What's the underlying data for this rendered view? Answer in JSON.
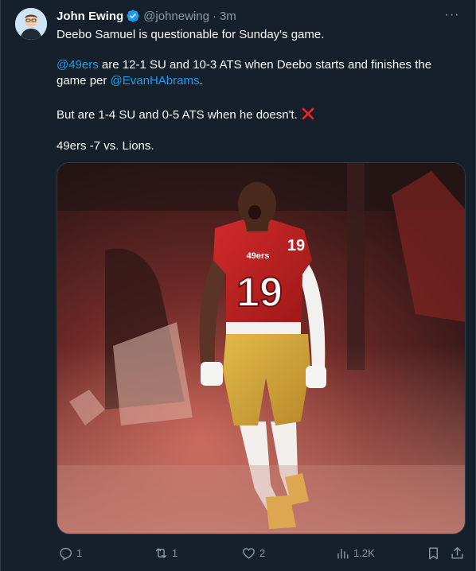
{
  "author": {
    "name": "John Ewing",
    "handle": "@johnewing",
    "separator": "·",
    "time": "3m"
  },
  "menu": {
    "label": "···"
  },
  "tweet": {
    "line1": "Deebo Samuel is questionable for Sunday's game.",
    "line2": {
      "mention1": "@49ers",
      "text_a": " are 12-1 SU and 10-3 ATS when Deebo starts and finishes the",
      "text_b": "game per ",
      "mention2": "@EvanHAbrams",
      "text_c": "."
    },
    "line3": "But are 1-4 SU and 0-5 ATS when he doesn't.",
    "line4": "49ers -7 vs. Lions."
  },
  "media": {
    "jersey_number": "19",
    "jersey_text": "49ers",
    "sleeve_number": "19"
  },
  "actions": {
    "replies": "1",
    "reposts": "1",
    "likes": "2",
    "views": "1.2K"
  },
  "colors": {
    "background": "#15202b",
    "link": "#1d9bf0",
    "muted": "#8b98a5",
    "verified": "#1d9bf0",
    "x_mark": "#f4212e"
  }
}
